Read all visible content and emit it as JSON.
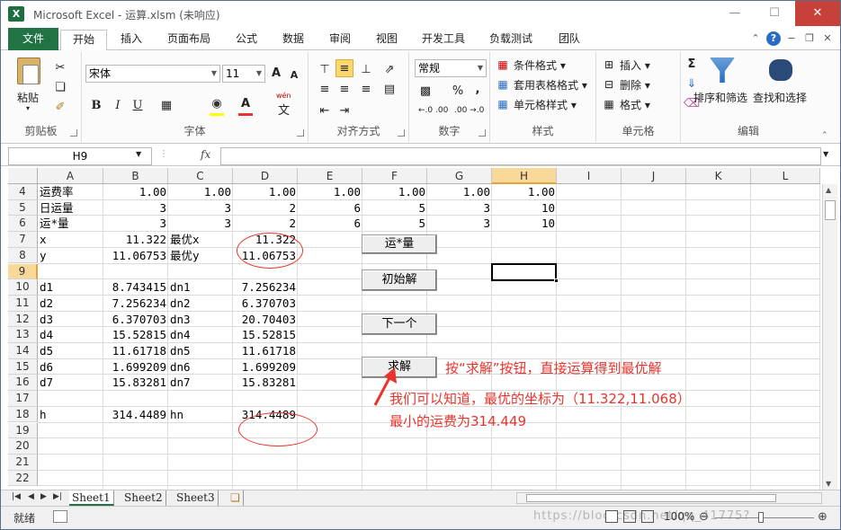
{
  "window": {
    "app_name": "Microsoft Excel",
    "separator": " - ",
    "file_name": "运算.xlsm",
    "state": "(未响应)"
  },
  "ribbon": {
    "file_tab": "文件",
    "tabs": [
      "开始",
      "插入",
      "页面布局",
      "公式",
      "数据",
      "审阅",
      "视图",
      "开发工具",
      "负载测试",
      "团队"
    ],
    "active_tab": "开始",
    "clipboard": {
      "paste": "粘贴",
      "label": "剪贴板"
    },
    "font": {
      "name": "宋体",
      "size": "11",
      "label": "字体",
      "bold": "B",
      "italic": "I",
      "underline": "U",
      "font_color_glyph": "A",
      "wen": "wén",
      "wen_char": "文",
      "grow": "A",
      "shrink": "A"
    },
    "alignment": {
      "label": "对齐方式"
    },
    "number": {
      "format": "常规",
      "label": "数字",
      "percent": "%",
      "comma": ",",
      "inc": "←.0 .00",
      "dec": ".00 →.0"
    },
    "styles": {
      "conditional": "条件格式",
      "table": "套用表格格式",
      "cell_styles": "单元格样式",
      "label": "样式"
    },
    "cells": {
      "insert": "插入",
      "delete": "删除",
      "format": "格式",
      "label": "单元格"
    },
    "editing": {
      "sum": "Σ",
      "sort": "排序和筛选",
      "find": "查找和选择",
      "label": "编辑"
    }
  },
  "formula_bar": {
    "name_box": "H9",
    "fx": "fx",
    "value": ""
  },
  "grid": {
    "columns": [
      "A",
      "B",
      "C",
      "D",
      "E",
      "F",
      "G",
      "H",
      "I",
      "J",
      "K",
      "L"
    ],
    "selected_column": "H",
    "rows": [
      "4",
      "5",
      "6",
      "7",
      "8",
      "9",
      "10",
      "11",
      "12",
      "13",
      "14",
      "15",
      "16",
      "17",
      "18",
      "19",
      "20",
      "21",
      "22"
    ],
    "selected_row": "9",
    "cells": {
      "A4": "运费率",
      "B4": "1.00",
      "C4": "1.00",
      "D4": "1.00",
      "E4": "1.00",
      "F4": "1.00",
      "G4": "1.00",
      "H4": "1.00",
      "A5": "日运量",
      "B5": "3",
      "C5": "3",
      "D5": "2",
      "E5": "6",
      "F5": "5",
      "G5": "3",
      "H5": "10",
      "A6": "运*量",
      "B6": "3",
      "C6": "3",
      "D6": "2",
      "E6": "6",
      "F6": "5",
      "G6": "3",
      "H6": "10",
      "A7": "x",
      "B7": "11.322",
      "C7": "最优x",
      "D7": "11.322",
      "A8": "y",
      "B8": "11.06753",
      "C8": "最优y",
      "D8": "11.06753",
      "A10": "d1",
      "B10": "8.743415",
      "C10": "dn1",
      "D10": "7.256234",
      "A11": "d2",
      "B11": "7.256234",
      "C11": "dn2",
      "D11": "6.370703",
      "A12": "d3",
      "B12": "6.370703",
      "C12": "dn3",
      "D12": "20.70403",
      "A13": "d4",
      "B13": "15.52815",
      "C13": "dn4",
      "D13": "15.52815",
      "A14": "d5",
      "B14": "11.61718",
      "C14": "dn5",
      "D14": "11.61718",
      "A15": "d6",
      "B15": "1.699209",
      "C15": "dn6",
      "D15": "1.699209",
      "A16": "d7",
      "B16": "15.83281",
      "C16": "dn7",
      "D16": "15.83281",
      "A18": "h",
      "B18": "314.4489",
      "C18": "hn",
      "D18": "314.4489"
    },
    "buttons": [
      "运*量",
      "初始解",
      "下一个",
      "求解"
    ]
  },
  "annotations": {
    "line1": "按“求解”按钮，直接运算得到最优解",
    "line2": "我们可以知道，最优的坐标为（11.322,11.068）",
    "line3": "最小的运费为314.449",
    "color": "#e8342c"
  },
  "sheets": [
    "Sheet1",
    "Sheet2",
    "Sheet3"
  ],
  "active_sheet": "Sheet1",
  "status": {
    "ready": "就绪",
    "zoom": "100%",
    "watermark": "https://blog.csdn.net/qq_41775?"
  },
  "colors": {
    "accent": "#217346",
    "selection": "#f9d99a"
  }
}
